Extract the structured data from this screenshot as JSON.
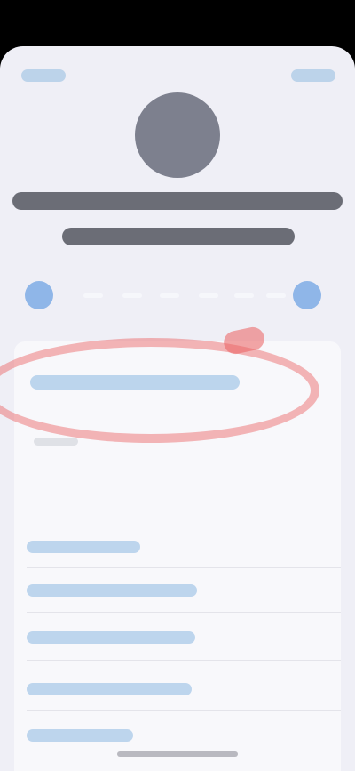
{
  "header": {
    "left_button": "",
    "right_button": ""
  },
  "contact": {
    "avatar_initials": "",
    "name": ""
  },
  "actions": [
    {
      "name": "message-action"
    },
    {
      "name": "call-action"
    },
    {
      "name": "video-action"
    },
    {
      "name": "mail-action"
    }
  ],
  "details": {
    "highlighted_row": "",
    "row_label": "",
    "rows": [
      "",
      "",
      "",
      "",
      ""
    ]
  },
  "colors": {
    "background": "#efeff6",
    "card": "#f8f8fb",
    "link_blue": "#bcd5ed",
    "avatar": "#7d808e",
    "annotation": "#eb5f5f"
  }
}
